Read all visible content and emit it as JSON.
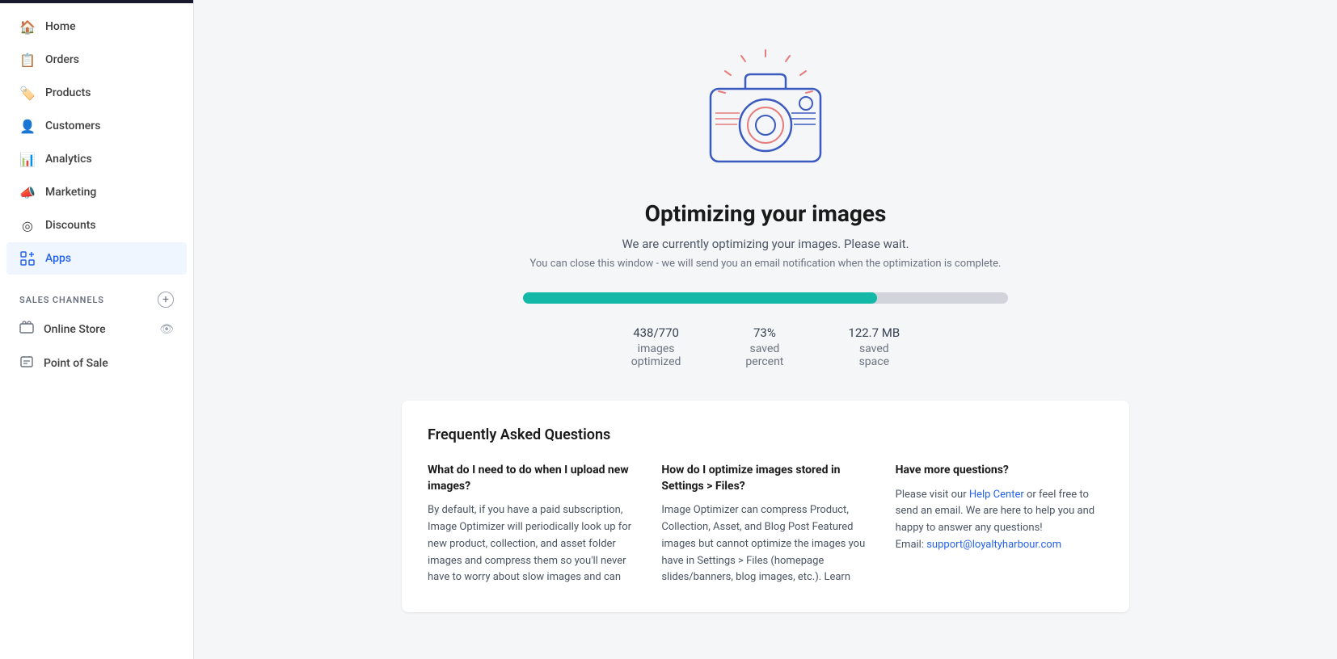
{
  "sidebar": {
    "nav_items": [
      {
        "id": "home",
        "label": "Home",
        "icon": "🏠"
      },
      {
        "id": "orders",
        "label": "Orders",
        "icon": "📋"
      },
      {
        "id": "products",
        "label": "Products",
        "icon": "🏷️"
      },
      {
        "id": "customers",
        "label": "Customers",
        "icon": "👤"
      },
      {
        "id": "analytics",
        "label": "Analytics",
        "icon": "📊"
      },
      {
        "id": "marketing",
        "label": "Marketing",
        "icon": "📣"
      },
      {
        "id": "discounts",
        "label": "Discounts",
        "icon": "⊙"
      },
      {
        "id": "apps",
        "label": "Apps",
        "icon": "⊞",
        "active": true
      }
    ],
    "sales_channels_label": "SALES CHANNELS",
    "channels": [
      {
        "id": "online-store",
        "label": "Online Store",
        "icon": "🖥️",
        "has_eye": true
      },
      {
        "id": "point-of-sale",
        "label": "Point of Sale",
        "icon": "🏬",
        "has_eye": false
      }
    ]
  },
  "main": {
    "title": "Optimizing your images",
    "subtitle": "We are currently optimizing your images. Please wait.",
    "note": "You can close this window - we will send you an email notification when the optimization is complete.",
    "progress_percent": 73,
    "stats": [
      {
        "value": "438/770",
        "label1": "images",
        "label2": "optimized"
      },
      {
        "value": "73%",
        "label1": "saved",
        "label2": "percent"
      },
      {
        "value": "122.7 MB",
        "label1": "saved",
        "label2": "space"
      }
    ],
    "faq": {
      "title": "Frequently Asked Questions",
      "columns": [
        {
          "title": "What do I need to do when I upload new images?",
          "text": "By default, if you have a paid subscription, Image Optimizer will periodically look up for new product, collection, and asset folder images and compress them so you'll never have to worry about slow images and can"
        },
        {
          "title": "How do I optimize images stored in Settings > Files?",
          "text": "Image Optimizer can compress Product, Collection, Asset, and Blog Post Featured images but cannot optimize the images you have in Settings > Files (homepage slides/banners, blog images, etc.). Learn"
        },
        {
          "title": "Have more questions?",
          "text_before": "Please visit our ",
          "link_text": "Help Center",
          "link_url": "#",
          "text_after": " or feel free to send an email. We are here to help you and happy to answer any questions!",
          "email_label": "Email: ",
          "email": "support@loyaltyharbour.com"
        }
      ]
    }
  }
}
